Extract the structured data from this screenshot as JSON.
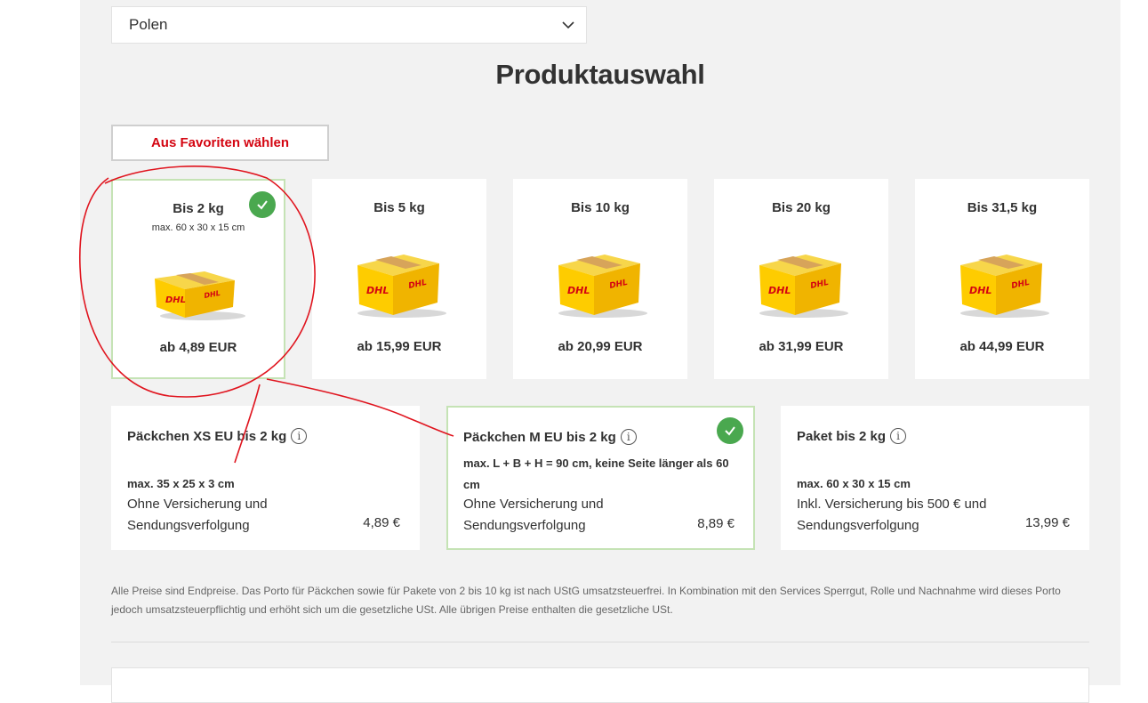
{
  "country_select": {
    "value": "Polen"
  },
  "page_title": "Produktauswahl",
  "favorites_button": "Aus Favoriten wählen",
  "weight_cards": [
    {
      "title": "Bis 2 kg",
      "subtitle": "max. 60 x 30 x 15 cm",
      "price": "ab 4,89 EUR",
      "selected": true
    },
    {
      "title": "Bis 5 kg",
      "subtitle": "",
      "price": "ab 15,99 EUR",
      "selected": false
    },
    {
      "title": "Bis 10 kg",
      "subtitle": "",
      "price": "ab 20,99 EUR",
      "selected": false
    },
    {
      "title": "Bis 20 kg",
      "subtitle": "",
      "price": "ab 31,99 EUR",
      "selected": false
    },
    {
      "title": "Bis 31,5 kg",
      "subtitle": "",
      "price": "ab 44,99 EUR",
      "selected": false
    }
  ],
  "product_cards": [
    {
      "title": "Päckchen XS EU bis 2 kg",
      "dimensions": "max. 35 x 25 x 3 cm",
      "description": "Ohne Versicherung und Sendungsverfolgung",
      "price": "4,89 €",
      "selected": false
    },
    {
      "title": "Päckchen M EU bis 2 kg",
      "dimensions": "max. L + B + H = 90 cm, keine Seite länger als 60 cm",
      "description": "Ohne Versicherung und Sendungsverfolgung",
      "price": "8,89 €",
      "selected": true
    },
    {
      "title": "Paket bis 2 kg",
      "dimensions": "max. 60 x 30 x 15 cm",
      "description": "Inkl. Versicherung bis 500 € und Sendungsverfolgung",
      "price": "13,99 €",
      "selected": false
    }
  ],
  "info_glyph": "i",
  "footnote": "Alle Preise sind Endpreise. Das Porto für Päckchen sowie für Pakete von 2 bis 10 kg ist nach UStG umsatzsteuerfrei. In Kombination mit den Services Sperrgut, Rolle und Nachnahme wird dieses Porto jedoch umsatzsteuerpflichtig und erhöht sich um die gesetzliche USt. Alle übrigen Preise enthalten die gesetzliche USt.",
  "box_logo": "DHL",
  "colors": {
    "accent": "#d40511",
    "selected_border": "#c5e3b5",
    "check": "#4aa84f",
    "box_yellow": "#fecc00",
    "annotation_red": "#e0141e"
  },
  "icons": [
    "chevron-down-icon",
    "check-icon",
    "info-icon",
    "dhl-box-icon"
  ]
}
